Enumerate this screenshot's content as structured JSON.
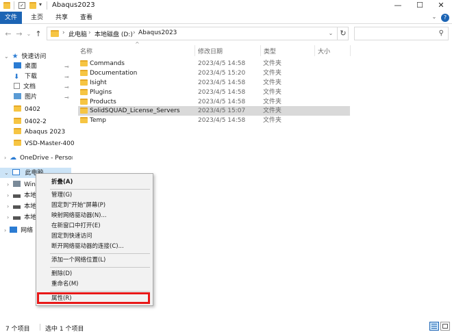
{
  "window": {
    "title": "Abaqus2023",
    "qat_dropdown": "▾",
    "minimize": "—",
    "maximize": "☐",
    "close": "✕"
  },
  "ribbon": {
    "tabs": [
      "文件",
      "主页",
      "共享",
      "查看"
    ],
    "toggle": "⌄",
    "help": "?"
  },
  "address": {
    "back": "←",
    "forward": "→",
    "recent": "⌄",
    "up": "↑",
    "crumbs": [
      "此电脑",
      "本地磁盘 (D:)",
      "Abaqus2023"
    ],
    "sep": "›",
    "dropdown": "⌄",
    "refresh": "↻",
    "search_placeholder": "",
    "search_icon": "⚲"
  },
  "nav": {
    "quick_access": "快速访问",
    "pinned": [
      {
        "label": "桌面",
        "icon": "desktop-icon",
        "color": "#2b7cd3"
      },
      {
        "label": "下载",
        "icon": "download-icon",
        "color": "#2b7cd3"
      },
      {
        "label": "文档",
        "icon": "documents-icon",
        "color": "#8a8a8a"
      },
      {
        "label": "图片",
        "icon": "pictures-icon",
        "color": "#5a9bd5"
      }
    ],
    "folders": [
      "0402",
      "0402-2",
      "Abaqus 2023",
      "VSD-Master-400"
    ],
    "onedrive": "OneDrive - Persona",
    "this_pc": "此电脑",
    "pc_children": [
      "Win",
      "本地",
      "本地",
      "本地"
    ],
    "network": "网络",
    "pin_glyph": "📌"
  },
  "columns": {
    "name": "名称",
    "date": "修改日期",
    "type": "类型",
    "size": "大小"
  },
  "files": [
    {
      "name": "Commands",
      "date": "2023/4/5 14:58",
      "type": "文件夹"
    },
    {
      "name": "Documentation",
      "date": "2023/4/5 15:20",
      "type": "文件夹"
    },
    {
      "name": "Isight",
      "date": "2023/4/5 14:58",
      "type": "文件夹"
    },
    {
      "name": "Plugins",
      "date": "2023/4/5 14:58",
      "type": "文件夹"
    },
    {
      "name": "Products",
      "date": "2023/4/5 14:58",
      "type": "文件夹"
    },
    {
      "name": "SolidSQUAD_License_Servers",
      "date": "2023/4/5 15:07",
      "type": "文件夹"
    },
    {
      "name": "Temp",
      "date": "2023/4/5 14:58",
      "type": "文件夹"
    }
  ],
  "context_menu": {
    "collapse": "折叠(A)",
    "manage": "管理(G)",
    "pin_start": "固定到\"开始\"屏幕(P)",
    "map_drive": "映射网络驱动器(N)...",
    "open_new_window": "在新窗口中打开(E)",
    "pin_quick": "固定到快速访问",
    "disconnect": "断开网络驱动器的连接(C)...",
    "add_location": "添加一个网络位置(L)",
    "delete": "删除(D)",
    "rename": "重命名(M)",
    "properties": "属性(R)",
    "highlight_color": "#e81818"
  },
  "status": {
    "count": "7 个项目",
    "selected": "选中 1 个项目"
  },
  "colors": {
    "accent": "#1c64b4",
    "folder": "#f6c543",
    "selection": "#d9d9d9"
  }
}
